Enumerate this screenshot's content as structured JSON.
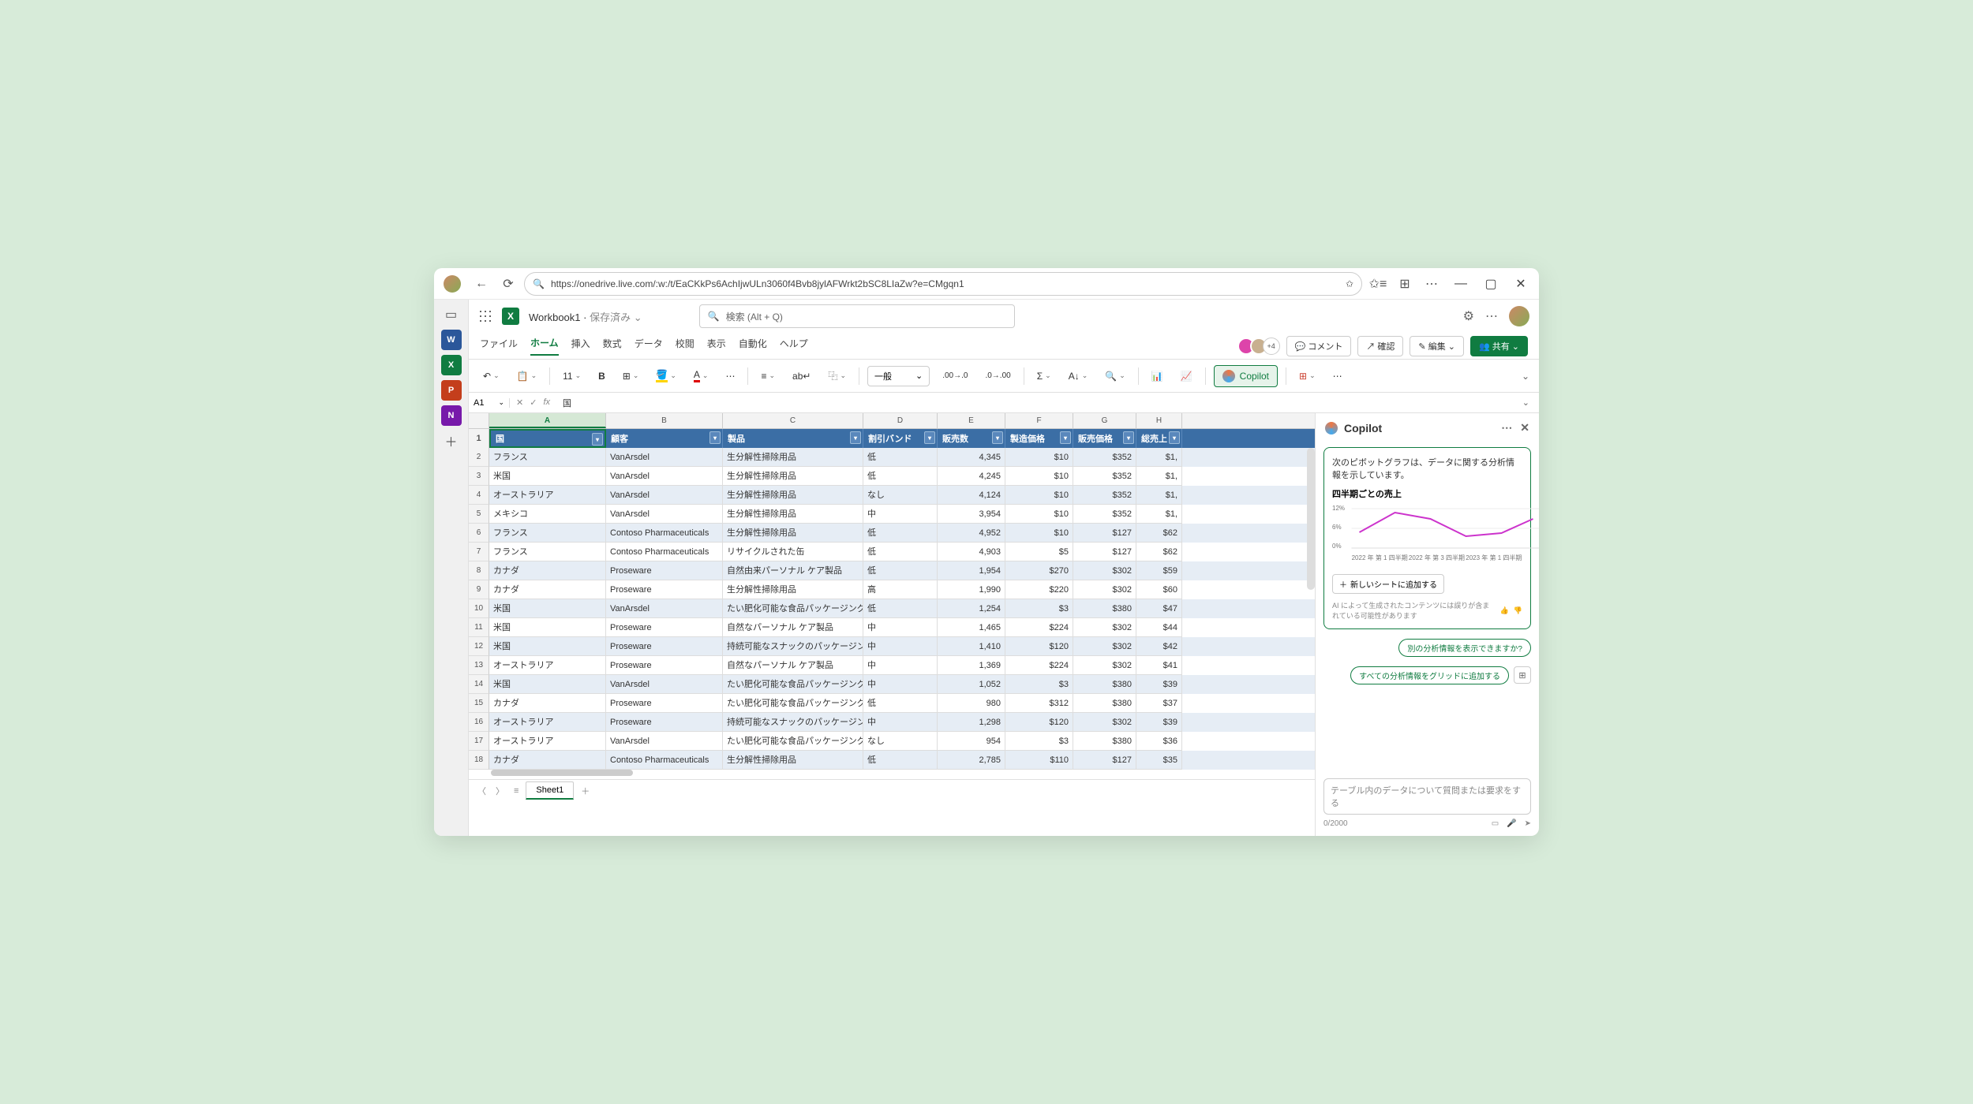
{
  "browser": {
    "url": "https://onedrive.live.com/:w:/t/EaCKkPs6AchIjwULn3060f4Bvb8jylAFWrkt2bSC8LIaZw?e=CMgqn1"
  },
  "workbook": {
    "name": "Workbook1",
    "status": "保存済み"
  },
  "search_placeholder": "検索 (Alt + Q)",
  "ribbon_tabs": [
    "ファイル",
    "ホーム",
    "挿入",
    "数式",
    "データ",
    "校閲",
    "表示",
    "自動化",
    "ヘルプ"
  ],
  "active_tab": "ホーム",
  "right_pills": {
    "comments": "コメント",
    "review": "確認",
    "edit": "編集",
    "share": "共有"
  },
  "facepile_more": "+4",
  "toolbar": {
    "font_size": "11",
    "number_format": "一般",
    "copilot": "Copilot"
  },
  "namebox": "A1",
  "formula_value": "国",
  "col_letters": [
    "A",
    "B",
    "C",
    "D",
    "E",
    "F",
    "G",
    "H"
  ],
  "headers": [
    "国",
    "顧客",
    "製品",
    "割引バンド",
    "販売数",
    "製造価格",
    "販売価格",
    "総売上"
  ],
  "rows": [
    {
      "n": 2,
      "c": [
        "フランス",
        "VanArsdel",
        "生分解性掃除用品",
        "低",
        "4,345",
        "$10",
        "$352",
        "$1,"
      ]
    },
    {
      "n": 3,
      "c": [
        "米国",
        "VanArsdel",
        "生分解性掃除用品",
        "低",
        "4,245",
        "$10",
        "$352",
        "$1,"
      ]
    },
    {
      "n": 4,
      "c": [
        "オーストラリア",
        "VanArsdel",
        "生分解性掃除用品",
        "なし",
        "4,124",
        "$10",
        "$352",
        "$1,"
      ]
    },
    {
      "n": 5,
      "c": [
        "メキシコ",
        "VanArsdel",
        "生分解性掃除用品",
        "中",
        "3,954",
        "$10",
        "$352",
        "$1,"
      ]
    },
    {
      "n": 6,
      "c": [
        "フランス",
        "Contoso Pharmaceuticals",
        "生分解性掃除用品",
        "低",
        "4,952",
        "$10",
        "$127",
        "$62"
      ]
    },
    {
      "n": 7,
      "c": [
        "フランス",
        "Contoso Pharmaceuticals",
        "リサイクルされた缶",
        "低",
        "4,903",
        "$5",
        "$127",
        "$62"
      ]
    },
    {
      "n": 8,
      "c": [
        "カナダ",
        "Proseware",
        "自然由来パーソナル ケア製品",
        "低",
        "1,954",
        "$270",
        "$302",
        "$59"
      ]
    },
    {
      "n": 9,
      "c": [
        "カナダ",
        "Proseware",
        "生分解性掃除用品",
        "高",
        "1,990",
        "$220",
        "$302",
        "$60"
      ]
    },
    {
      "n": 10,
      "c": [
        "米国",
        "VanArsdel",
        "たい肥化可能な食品パッケージング",
        "低",
        "1,254",
        "$3",
        "$380",
        "$47"
      ]
    },
    {
      "n": 11,
      "c": [
        "米国",
        "Proseware",
        "自然なパーソナル ケア製品",
        "中",
        "1,465",
        "$224",
        "$302",
        "$44"
      ]
    },
    {
      "n": 12,
      "c": [
        "米国",
        "Proseware",
        "持続可能なスナックのパッケージング",
        "中",
        "1,410",
        "$120",
        "$302",
        "$42"
      ]
    },
    {
      "n": 13,
      "c": [
        "オーストラリア",
        "Proseware",
        "自然なパーソナル ケア製品",
        "中",
        "1,369",
        "$224",
        "$302",
        "$41"
      ]
    },
    {
      "n": 14,
      "c": [
        "米国",
        "VanArsdel",
        "たい肥化可能な食品パッケージング",
        "中",
        "1,052",
        "$3",
        "$380",
        "$39"
      ]
    },
    {
      "n": 15,
      "c": [
        "カナダ",
        "Proseware",
        "たい肥化可能な食品パッケージング",
        "低",
        "980",
        "$312",
        "$380",
        "$37"
      ]
    },
    {
      "n": 16,
      "c": [
        "オーストラリア",
        "Proseware",
        "持続可能なスナックのパッケージング",
        "中",
        "1,298",
        "$120",
        "$302",
        "$39"
      ]
    },
    {
      "n": 17,
      "c": [
        "オーストラリア",
        "VanArsdel",
        "たい肥化可能な食品パッケージング",
        "なし",
        "954",
        "$3",
        "$380",
        "$36"
      ]
    },
    {
      "n": 18,
      "c": [
        "カナダ",
        "Contoso Pharmaceuticals",
        "生分解性掃除用品",
        "低",
        "2,785",
        "$110",
        "$127",
        "$35"
      ]
    }
  ],
  "sheet_tabs": [
    "Sheet1"
  ],
  "copilot": {
    "title": "Copilot",
    "card_text": "次のピボットグラフは、データに関する分析情報を示しています。",
    "chart_title": "四半期ごとの売上",
    "add_button": "新しいシートに追加する",
    "disclaimer": "AI によって生成されたコンテンツには誤りが含まれている可能性があります",
    "suggest1": "別の分析情報を表示できますか?",
    "suggest2": "すべての分析情報をグリッドに追加する",
    "input_placeholder": "テーブル内のデータについて質問または要求をする",
    "counter": "0/2000"
  },
  "chart_data": {
    "type": "line",
    "title": "四半期ごとの売上",
    "ylabel": "",
    "ylim": [
      0,
      14
    ],
    "y_ticks": [
      "0%",
      "6%",
      "12%"
    ],
    "categories": [
      "2022 年 第 1 四半期",
      "2022 年 第 3 四半期",
      "2023 年 第 1 四半期"
    ],
    "series": [
      {
        "name": "売上",
        "values": [
          8,
          13,
          11,
          7,
          8,
          11
        ]
      }
    ]
  }
}
